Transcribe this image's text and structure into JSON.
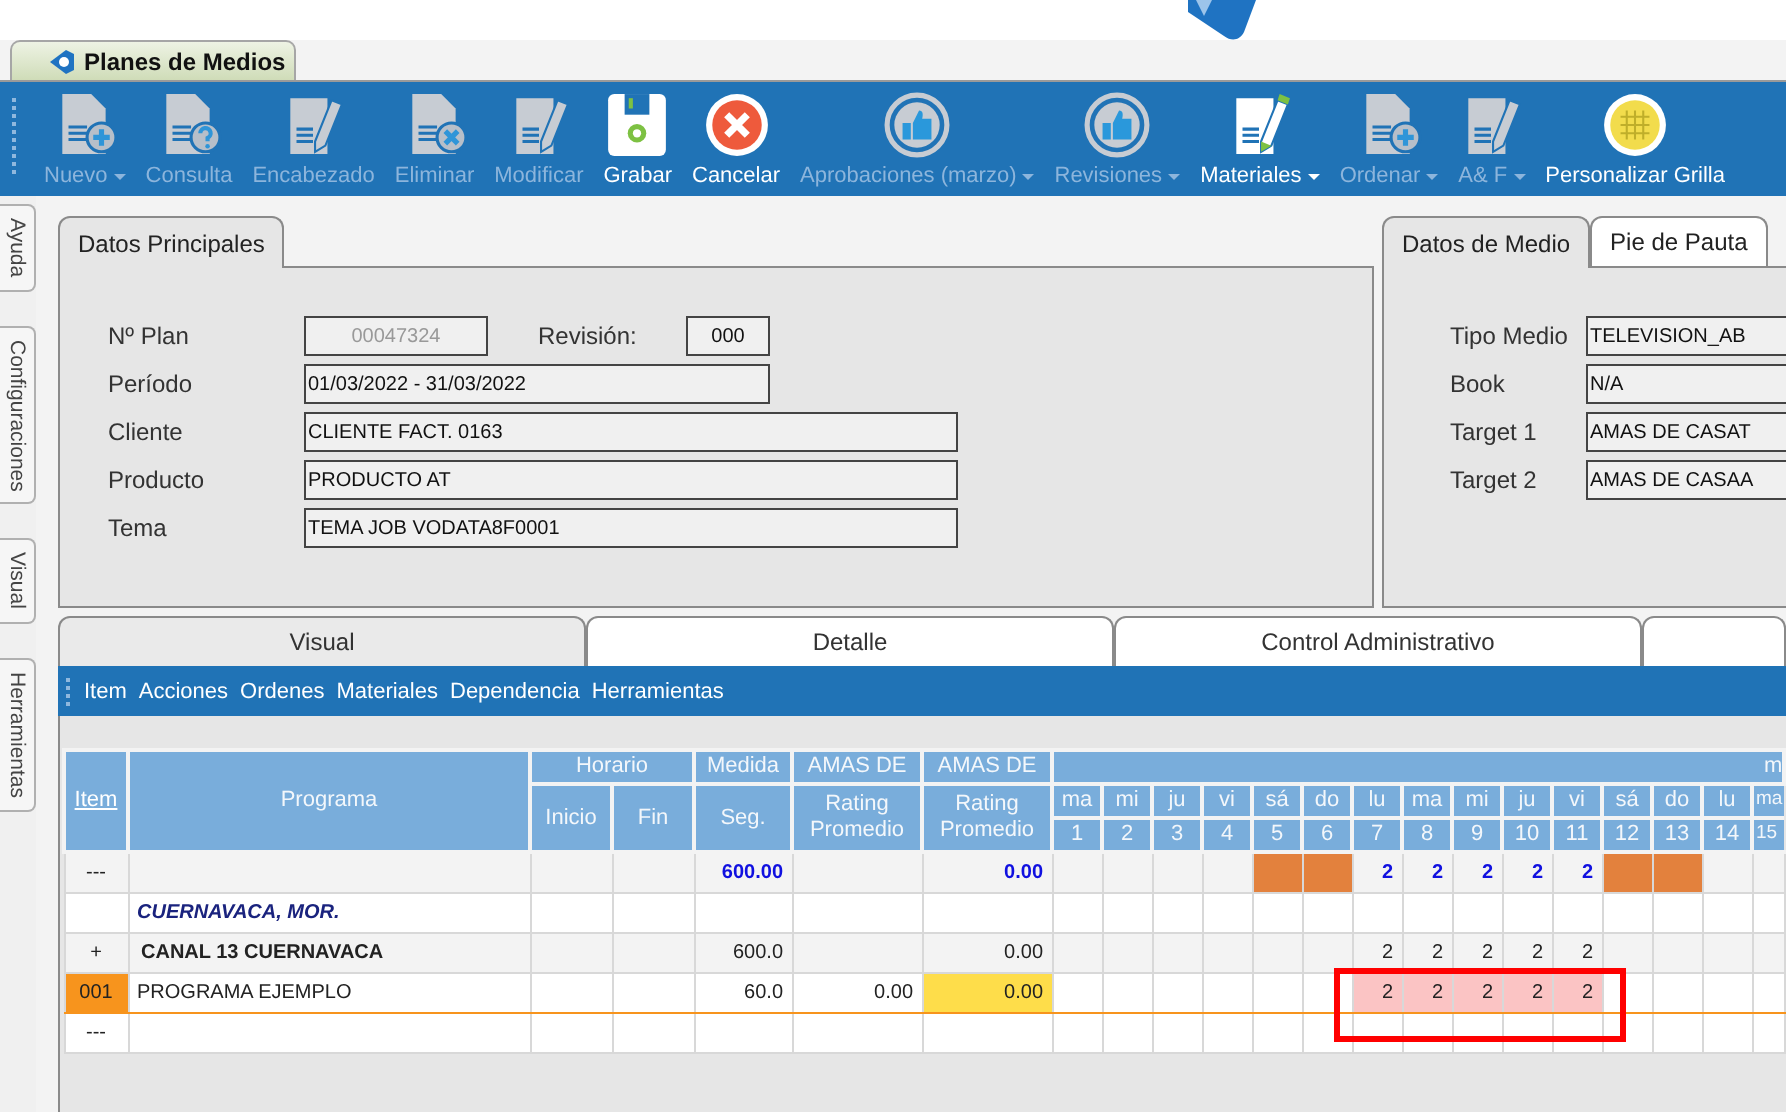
{
  "app_tabs": [
    {
      "label": "Planes de Medios",
      "selected": true
    }
  ],
  "toolbar": [
    {
      "label": "Nuevo",
      "kind": "doc-plus",
      "disabled": true,
      "dropdown": true
    },
    {
      "label": "Consulta",
      "kind": "doc-question",
      "disabled": true,
      "dropdown": false
    },
    {
      "label": "Encabezado",
      "kind": "doc-pencil",
      "disabled": true,
      "dropdown": false
    },
    {
      "label": "Eliminar",
      "kind": "doc-x",
      "disabled": true,
      "dropdown": false
    },
    {
      "label": "Modificar",
      "kind": "doc-pencil",
      "disabled": true,
      "dropdown": false
    },
    {
      "label": "Grabar",
      "kind": "save",
      "disabled": false,
      "dropdown": false
    },
    {
      "label": "Cancelar",
      "kind": "cancel",
      "disabled": false,
      "dropdown": false
    },
    {
      "label": "Aprobaciones (marzo)",
      "kind": "thumb",
      "disabled": true,
      "dropdown": true
    },
    {
      "label": "Revisiones",
      "kind": "thumb",
      "disabled": true,
      "dropdown": true
    },
    {
      "label": "Materiales",
      "kind": "materials",
      "disabled": false,
      "dropdown": true
    },
    {
      "label": "Ordenar",
      "kind": "doc-plus",
      "disabled": true,
      "dropdown": true
    },
    {
      "label": "A& F",
      "kind": "doc-pencil",
      "disabled": true,
      "dropdown": true
    },
    {
      "label": "Personalizar Grilla",
      "kind": "grid",
      "disabled": false,
      "dropdown": false
    }
  ],
  "side_tabs": [
    {
      "label": "Ayuda"
    },
    {
      "label": "Configuraciones"
    },
    {
      "label": "Visual"
    },
    {
      "label": "Herramientas"
    }
  ],
  "main_panel": {
    "tabs": [
      {
        "label": "Datos Principales",
        "selected": true
      }
    ],
    "fields": [
      {
        "kind": "plan",
        "label": "Nº Plan",
        "value": "00047324",
        "disabled": true,
        "revision": {
          "label": "Revisión:",
          "value": "000"
        }
      },
      {
        "kind": "medium",
        "label": "Período",
        "value": "01/03/2022 - 31/03/2022",
        "disabled": false
      },
      {
        "kind": "long",
        "label": "Cliente",
        "value": "CLIENTE FACT. 0163",
        "disabled": false
      },
      {
        "kind": "long",
        "label": "Producto",
        "value": "PRODUCTO AT",
        "disabled": false
      },
      {
        "kind": "long",
        "label": "Tema",
        "value": "TEMA JOB VODATA8F0001",
        "disabled": false
      }
    ]
  },
  "media_panel": {
    "tabs": [
      {
        "label": "Datos de Medio",
        "selected": true
      },
      {
        "label": "Pie de Pauta",
        "selected": false
      }
    ],
    "fields": [
      {
        "label": "Tipo Medio",
        "value": "TELEVISION_AB"
      },
      {
        "label": "Book",
        "value": "N/A"
      },
      {
        "label": "Target 1",
        "value": "AMAS DE CASAT"
      },
      {
        "label": "Target 2",
        "value": "AMAS DE CASAA"
      }
    ]
  },
  "view_tabs": [
    {
      "label": "Visual",
      "selected": true
    },
    {
      "label": "Detalle",
      "selected": false
    },
    {
      "label": "Control Administrativo",
      "selected": false
    }
  ],
  "menu": [
    "Item",
    "Acciones",
    "Ordenes",
    "Materiales",
    "Dependencia",
    "Herramientas"
  ],
  "grid": {
    "headers": {
      "item": "Item",
      "programa": "Programa",
      "horario": "Horario",
      "inicio": "Inicio",
      "fin": "Fin",
      "medida": "Medida",
      "seg": "Seg.",
      "target1": "AMAS DE",
      "rating1": "Rating Promedio",
      "target2": "AMAS DE",
      "rating2": "Rating Promedio",
      "month": "m"
    },
    "days": [
      {
        "name": "ma",
        "number": "1"
      },
      {
        "name": "mi",
        "number": "2"
      },
      {
        "name": "ju",
        "number": "3"
      },
      {
        "name": "vi",
        "number": "4"
      },
      {
        "name": "sá",
        "number": "5"
      },
      {
        "name": "do",
        "number": "6"
      },
      {
        "name": "lu",
        "number": "7"
      },
      {
        "name": "ma",
        "number": "8"
      },
      {
        "name": "mi",
        "number": "9"
      },
      {
        "name": "ju",
        "number": "10"
      },
      {
        "name": "vi",
        "number": "11"
      },
      {
        "name": "sá",
        "number": "12"
      },
      {
        "name": "do",
        "number": "13"
      },
      {
        "name": "lu",
        "number": "14"
      },
      {
        "name": "ma",
        "number": "15"
      }
    ],
    "rows": [
      {
        "kind": "total",
        "selected": false,
        "item": "---",
        "seg": "600.00",
        "rating2": "0.00",
        "days": [
          {
            "blocked": false
          },
          {
            "blocked": false
          },
          {
            "blocked": false
          },
          {
            "blocked": false
          },
          {
            "blocked": true
          },
          {
            "blocked": true
          },
          {
            "value": "2",
            "blocked": false
          },
          {
            "value": "2",
            "blocked": false
          },
          {
            "value": "2",
            "blocked": false
          },
          {
            "value": "2",
            "blocked": false
          },
          {
            "value": "2",
            "blocked": false
          },
          {
            "blocked": true
          },
          {
            "blocked": true
          },
          {
            "blocked": false
          },
          {
            "blocked": false
          }
        ]
      },
      {
        "kind": "region",
        "selected": false,
        "programa": "CUERNAVACA, MOR."
      },
      {
        "kind": "channel",
        "selected": false,
        "item": "+",
        "programa": "CANAL 13 CUERNAVACA",
        "seg": "600.0",
        "rating2": "0.00",
        "days": [
          {
            "blocked": false
          },
          {
            "blocked": false
          },
          {
            "blocked": false
          },
          {
            "blocked": false
          },
          {
            "blocked": false
          },
          {
            "blocked": false
          },
          {
            "value": "2",
            "blocked": false
          },
          {
            "value": "2",
            "blocked": false
          },
          {
            "value": "2",
            "blocked": false
          },
          {
            "value": "2",
            "blocked": false
          },
          {
            "value": "2",
            "blocked": false
          },
          {
            "blocked": false
          },
          {
            "blocked": false
          },
          {
            "blocked": false
          },
          {
            "blocked": false
          }
        ]
      },
      {
        "kind": "program",
        "selected": true,
        "item": "001",
        "programa": "PROGRAMA EJEMPLO",
        "seg": "60.0",
        "rating1": "0.00",
        "rating2": "0.00",
        "rating2_warning": true,
        "days": [
          {
            "scheduled": false
          },
          {
            "scheduled": false
          },
          {
            "scheduled": false
          },
          {
            "scheduled": false
          },
          {
            "scheduled": false
          },
          {
            "scheduled": false
          },
          {
            "value": "2",
            "scheduled": true
          },
          {
            "value": "2",
            "scheduled": true
          },
          {
            "value": "2",
            "scheduled": true
          },
          {
            "value": "2",
            "scheduled": true
          },
          {
            "value": "2",
            "scheduled": true
          },
          {
            "scheduled": false
          },
          {
            "scheduled": false
          },
          {
            "scheduled": false
          },
          {
            "scheduled": false
          }
        ]
      },
      {
        "kind": "new",
        "selected": false,
        "item": "---"
      }
    ]
  }
}
